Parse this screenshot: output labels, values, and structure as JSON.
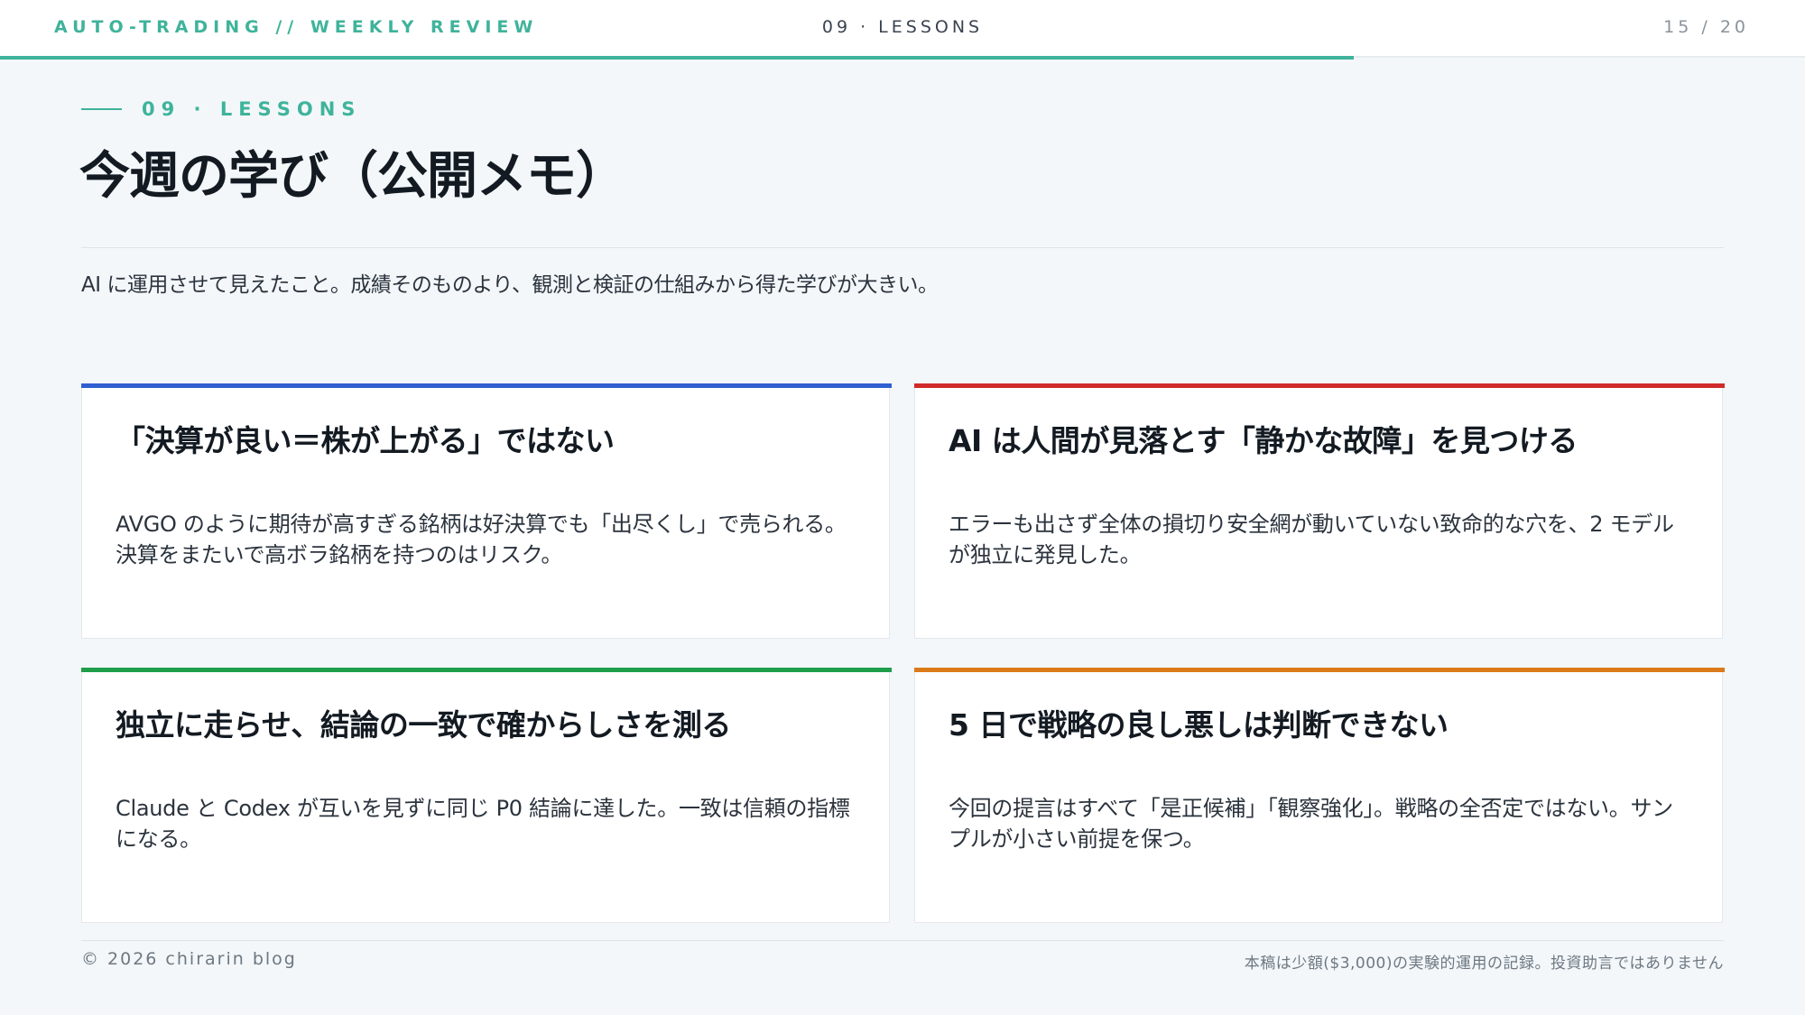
{
  "header": {
    "brand": "AUTO-TRADING // WEEKLY REVIEW",
    "section": "09 · LESSONS",
    "page_indicator": "15 / 20",
    "progress": 0.75,
    "accent_color": "#3fb39b"
  },
  "main": {
    "eyebrow": "09 · LESSONS",
    "title": "今週の学び（公開メモ）",
    "subtitle": "AI に運用させて見えたこと。成績そのものより、観測と検証の仕組みから得た学びが大きい。",
    "cards": [
      {
        "title": "「決算が良い＝株が上がる」ではない",
        "body": "AVGO のように期待が高すぎる銘柄は好決算でも「出尽くし」で売られる。決算をまたいで高ボラ銘柄を持つのはリスク。",
        "color": "#2f5fd0"
      },
      {
        "title": "AI は人間が見落とす「静かな故障」を見つける",
        "body": "エラーも出さず全体の損切り安全網が動いていない致命的な穴を、2 モデルが独立に発見した。",
        "color": "#d02a2a"
      },
      {
        "title": "独立に走らせ、結論の一致で確からしさを測る",
        "body": "Claude と Codex が互いを見ずに同じ P0 結論に達した。一致は信頼の指標になる。",
        "color": "#1f9e4b"
      },
      {
        "title": "5 日で戦略の良し悪しは判断できない",
        "body": "今回の提言はすべて「是正候補」「観察強化」。戦略の全否定ではない。サンプルが小さい前提を保つ。",
        "color": "#dc7a1a"
      }
    ]
  },
  "footer": {
    "copyright": "© 2026 chirarin blog",
    "disclaimer": "本稿は少額($3,000)の実験的運用の記録。投資助言ではありません"
  }
}
